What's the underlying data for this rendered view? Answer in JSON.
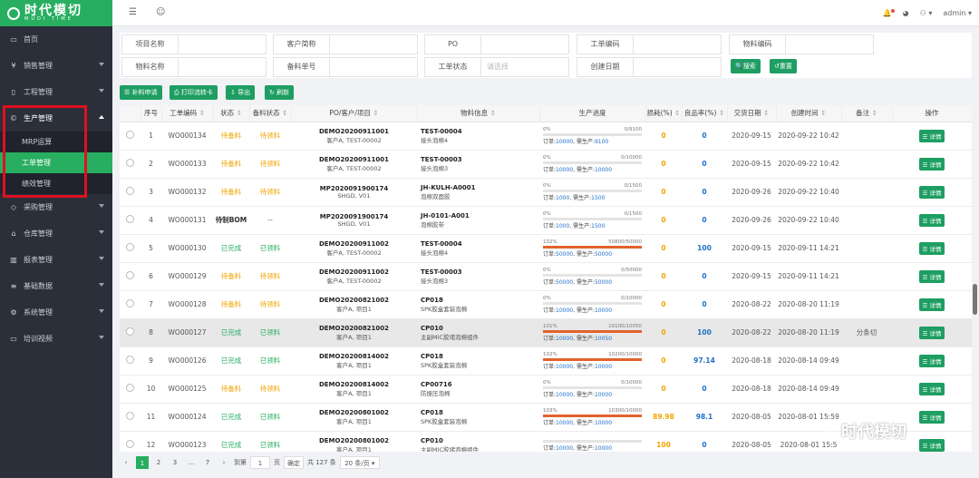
{
  "brand": {
    "name": "时代模切",
    "sub": "MUDI TIME"
  },
  "header": {
    "user": "admin"
  },
  "sidebar": {
    "items": [
      {
        "label": "首页",
        "icon": "monitor-icon"
      },
      {
        "label": "销售管理",
        "icon": "yen-icon"
      },
      {
        "label": "工程管理",
        "icon": "doc-icon"
      },
      {
        "label": "生产管理",
        "icon": "copyright-icon"
      },
      {
        "label": "采购管理",
        "icon": "handshake-icon"
      },
      {
        "label": "仓库管理",
        "icon": "home-icon"
      },
      {
        "label": "报表管理",
        "icon": "chart-icon"
      },
      {
        "label": "基础数据",
        "icon": "list-icon"
      },
      {
        "label": "系统管理",
        "icon": "gear-icon"
      },
      {
        "label": "培训视频",
        "icon": "monitor-icon"
      }
    ],
    "sub": [
      "MRP运算",
      "工单管理",
      "绩效管理"
    ]
  },
  "search": {
    "f1": "项目名称",
    "f2": "客户简称",
    "f3": "PO",
    "f4": "工单编码",
    "f5": "物料编码",
    "f6": "物料名称",
    "f7": "备料单号",
    "f8": "工单状态",
    "f8ph": "请选择",
    "f9": "创建日期",
    "btn_search": "搜索",
    "btn_reset": "重置"
  },
  "toolbar": {
    "b1": "补料申请",
    "b2": "打印流转卡",
    "b3": "导出",
    "b4": "刷新"
  },
  "cols": [
    "序号",
    "工单编码",
    "状态",
    "备料状态",
    "PO/客户/项目",
    "物料信息",
    "生产进度",
    "损耗(%)",
    "良品率(%)",
    "交货日期",
    "创建时间",
    "备注",
    "操作"
  ],
  "rows": [
    {
      "n": "1",
      "code": "WO000134",
      "st": "待备料",
      "bst": "待领料",
      "po1": "DEMO20200911001",
      "po2": "客户A, TEST-00002",
      "m1": "TEST-00004",
      "m2": "接头泡棉4",
      "pct": "0%",
      "frac": "0/9100",
      "p": 0,
      "ord": "10000",
      "need": "9100",
      "loss": "0",
      "yield": "0",
      "dd": "2020-09-15",
      "ct": "2020-09-22 10:42",
      "note": "",
      "sc": "orange",
      "bc": "orange"
    },
    {
      "n": "2",
      "code": "WO000133",
      "st": "待备料",
      "bst": "待领料",
      "po1": "DEMO20200911001",
      "po2": "客户A, TEST-00002",
      "m1": "TEST-00003",
      "m2": "接头泡棉3",
      "pct": "0%",
      "frac": "0/10000",
      "p": 0,
      "ord": "10000",
      "need": "10000",
      "loss": "0",
      "yield": "0",
      "dd": "2020-09-15",
      "ct": "2020-09-22 10:42",
      "note": "",
      "sc": "orange",
      "bc": "orange"
    },
    {
      "n": "3",
      "code": "WO000132",
      "st": "待备料",
      "bst": "待领料",
      "po1": "MP2020091900174",
      "po2": "SHGD, V01",
      "m1": "JH-KULH-A0001",
      "m2": "泡棉双面胶",
      "pct": "0%",
      "frac": "0/1500",
      "p": 0,
      "ord": "1000",
      "need": "1500",
      "loss": "0",
      "yield": "0",
      "dd": "2020-09-26",
      "ct": "2020-09-22 10:40",
      "note": "",
      "sc": "orange",
      "bc": "orange"
    },
    {
      "n": "4",
      "code": "WO000131",
      "st": "待制BOM",
      "bst": "--",
      "po1": "MP2020091900174",
      "po2": "SHGD, V01",
      "m1": "JH-0101-A001",
      "m2": "泡棉胶带",
      "pct": "0%",
      "frac": "0/1500",
      "p": 0,
      "ord": "1000",
      "need": "1500",
      "loss": "0",
      "yield": "0",
      "dd": "2020-09-26",
      "ct": "2020-09-22 10:40",
      "note": "",
      "sc": "bold",
      "bc": ""
    },
    {
      "n": "5",
      "code": "WO000130",
      "st": "已完成",
      "bst": "已领料",
      "po1": "DEMO20200911002",
      "po2": "客户A, TEST-00002",
      "m1": "TEST-00004",
      "m2": "接头泡棉4",
      "pct": "102%",
      "frac": "50800/50000",
      "p": 100,
      "ord": "50000",
      "need": "50000",
      "loss": "0",
      "yield": "100",
      "dd": "2020-09-15",
      "ct": "2020-09-11 14:21",
      "note": "",
      "sc": "green",
      "bc": "green"
    },
    {
      "n": "6",
      "code": "WO000129",
      "st": "待备料",
      "bst": "待领料",
      "po1": "DEMO20200911002",
      "po2": "客户A, TEST-00002",
      "m1": "TEST-00003",
      "m2": "接头泡棉3",
      "pct": "0%",
      "frac": "0/50000",
      "p": 0,
      "ord": "50000",
      "need": "50000",
      "loss": "0",
      "yield": "0",
      "dd": "2020-09-15",
      "ct": "2020-09-11 14:21",
      "note": "",
      "sc": "orange",
      "bc": "orange"
    },
    {
      "n": "7",
      "code": "WO000128",
      "st": "待备料",
      "bst": "待领料",
      "po1": "DEMO20200821002",
      "po2": "客户A, 项目1",
      "m1": "CP018",
      "m2": "SPK胶盒套装泡棉",
      "pct": "0%",
      "frac": "0/10000",
      "p": 0,
      "ord": "10000",
      "need": "10000",
      "loss": "0",
      "yield": "0",
      "dd": "2020-08-22",
      "ct": "2020-08-20 11:19",
      "note": "",
      "sc": "orange",
      "bc": "orange"
    },
    {
      "n": "8",
      "code": "WO000127",
      "st": "已完成",
      "bst": "已领料",
      "po1": "DEMO20200821002",
      "po2": "客户A, 项目1",
      "m1": "CP010",
      "m2": "主副MIC胶堵泡棉组件",
      "pct": "101%",
      "frac": "10100/10050",
      "p": 100,
      "ord": "10000",
      "need": "10050",
      "loss": "0",
      "yield": "100",
      "dd": "2020-08-22",
      "ct": "2020-08-20 11:19",
      "note": "分条切",
      "sc": "green",
      "bc": "green",
      "hl": true
    },
    {
      "n": "9",
      "code": "WO000126",
      "st": "已完成",
      "bst": "已领料",
      "po1": "DEMO20200814002",
      "po2": "客户A, 项目1",
      "m1": "CP018",
      "m2": "SPK胶盒套装泡棉",
      "pct": "102%",
      "frac": "10200/10000",
      "p": 100,
      "ord": "10000",
      "need": "10000",
      "loss": "0",
      "yield": "97.14",
      "dd": "2020-08-18",
      "ct": "2020-08-14 09:49",
      "note": "",
      "sc": "green",
      "bc": "green"
    },
    {
      "n": "10",
      "code": "WO000125",
      "st": "待备料",
      "bst": "待领料",
      "po1": "DEMO20200814002",
      "po2": "客户A, 项目1",
      "m1": "CP00716",
      "m2": "防振压泡棉",
      "pct": "0%",
      "frac": "0/10000",
      "p": 0,
      "ord": "10000",
      "need": "10000",
      "loss": "0",
      "yield": "0",
      "dd": "2020-08-18",
      "ct": "2020-08-14 09:49",
      "note": "",
      "sc": "orange",
      "bc": "orange"
    },
    {
      "n": "11",
      "code": "WO000124",
      "st": "已完成",
      "bst": "已领料",
      "po1": "DEMO20200801002",
      "po2": "客户A, 项目1",
      "m1": "CP018",
      "m2": "SPK胶盒套装泡棉",
      "pct": "103%",
      "frac": "10300/10000",
      "p": 100,
      "ord": "10000",
      "need": "10000",
      "loss": "89.98",
      "yield": "98.1",
      "dd": "2020-08-05",
      "ct": "2020-08-01 15:59",
      "note": "",
      "sc": "green",
      "bc": "green"
    },
    {
      "n": "12",
      "code": "WO000123",
      "st": "已完成",
      "bst": "已领料",
      "po1": "DEMO20200801002",
      "po2": "客户A, 项目1",
      "m1": "CP010",
      "m2": "主副MIC胶堵泡棉组件",
      "pct": "",
      "frac": "",
      "p": 0,
      "ord": "10000",
      "need": "10000",
      "loss": "100",
      "yield": "0",
      "dd": "2020-08-05",
      "ct": "2020-08-01 15:5",
      "note": "",
      "sc": "green",
      "bc": "green"
    }
  ],
  "progress_labels": {
    "ord": "订单:",
    "need": "需生产:"
  },
  "detail": "详情",
  "pager": {
    "pages": [
      "1",
      "2",
      "3",
      "...",
      "7"
    ],
    "goto": "到第",
    "page": "1",
    "page_unit": "页",
    "confirm": "确定",
    "total": "共 127 条",
    "size": "20 条/页"
  },
  "watermark": "时代模切"
}
